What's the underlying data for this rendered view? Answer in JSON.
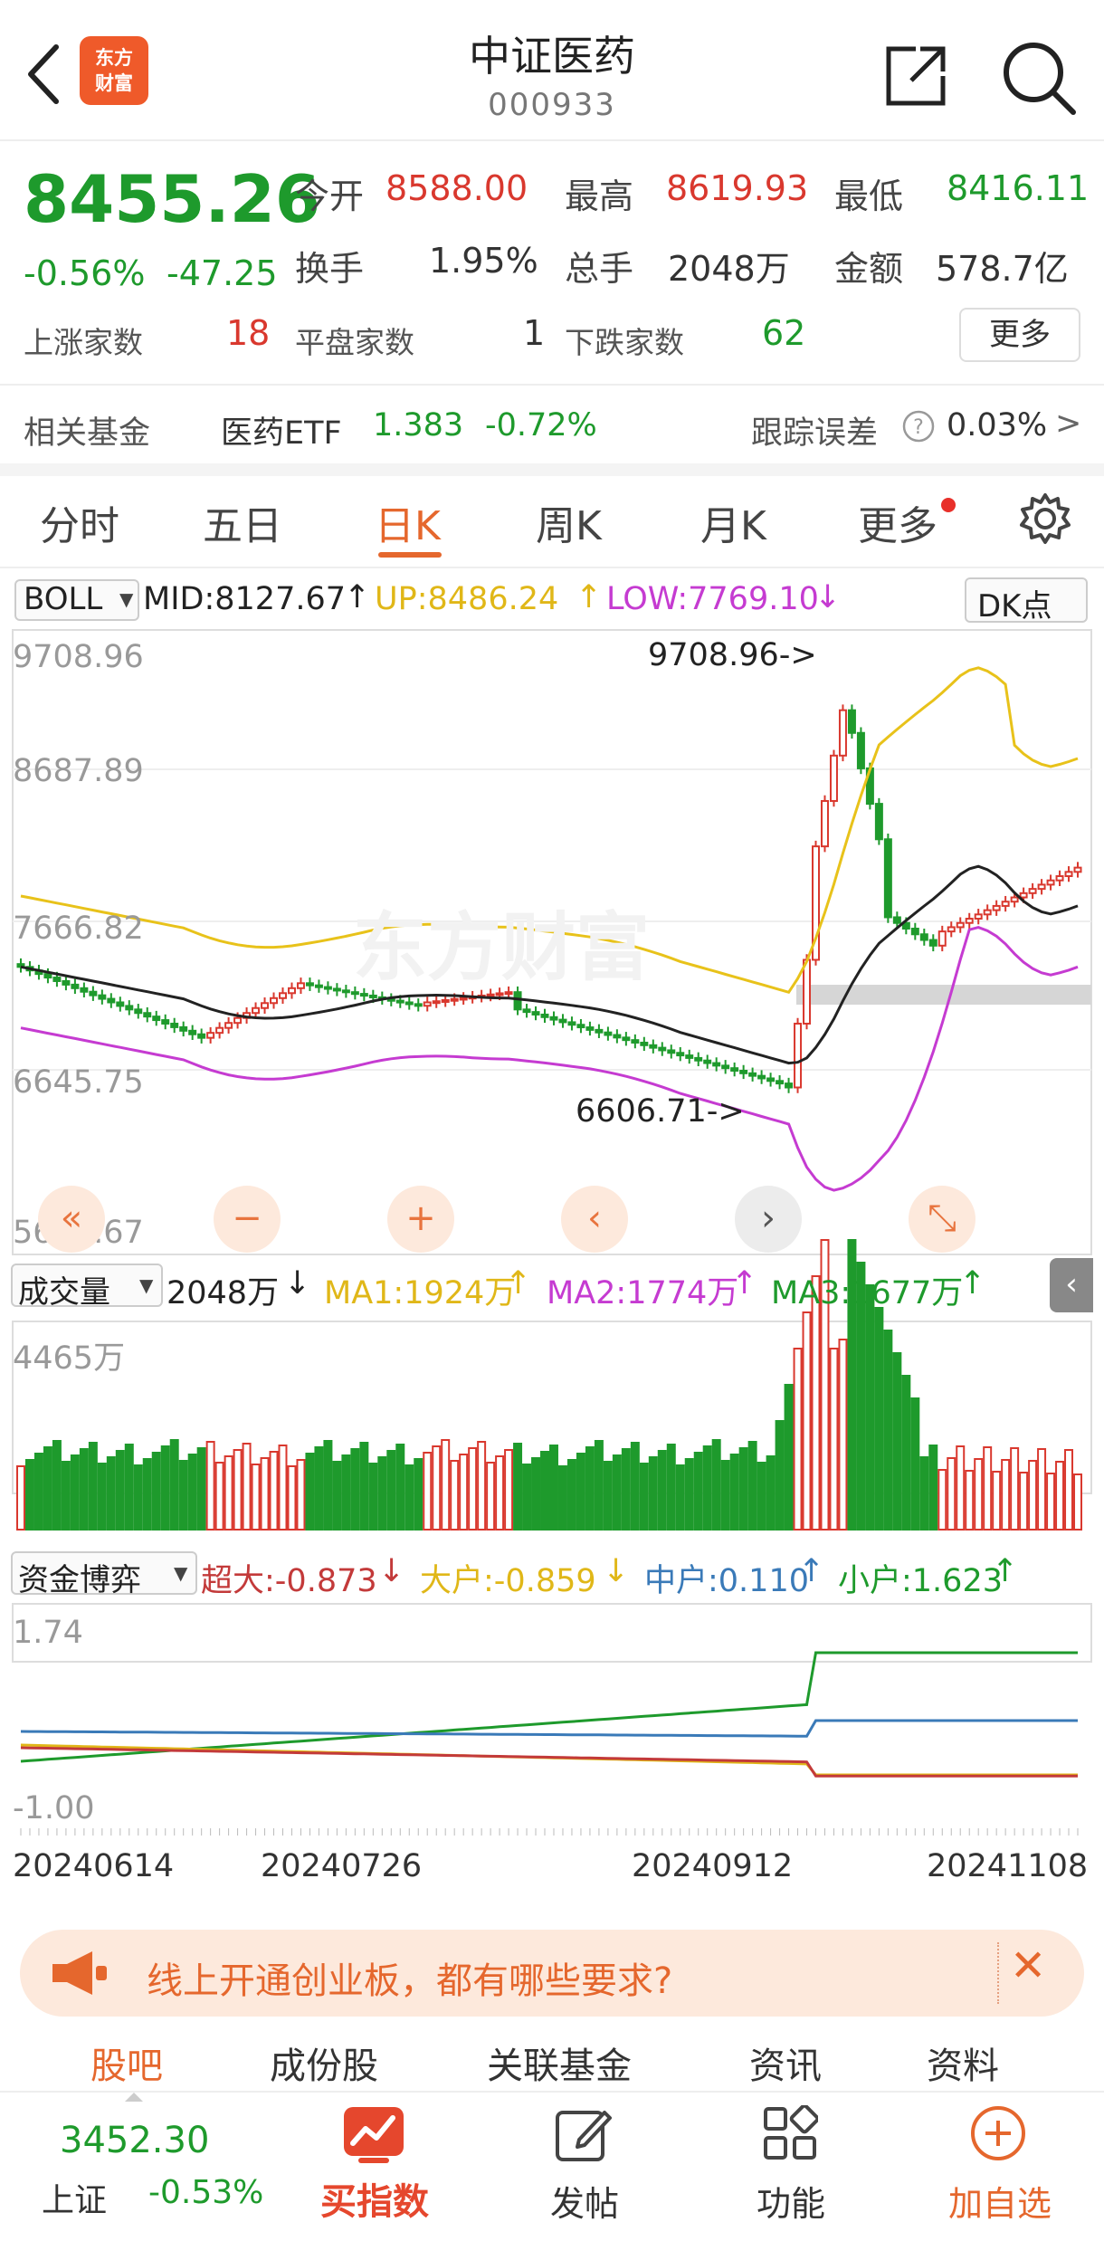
{
  "header": {
    "title": "中证医药",
    "code": "000933"
  },
  "quote": {
    "price": "8455.26",
    "change_pct": "-0.56%",
    "change": "-47.25",
    "open_label": "今开",
    "open": "8588.00",
    "high_label": "最高",
    "high": "8619.93",
    "low_label": "最低",
    "low": "8416.11",
    "turnover_label": "换手",
    "turnover": "1.95%",
    "volume_label": "总手",
    "volume": "2048万",
    "amount_label": "金额",
    "amount": "578.7亿",
    "up_label": "上涨家数",
    "up": "18",
    "flat_label": "平盘家数",
    "flat": "1",
    "down_label": "下跌家数",
    "down": "62",
    "more_button": "更多"
  },
  "fund": {
    "label": "相关基金",
    "name": "医药ETF",
    "price": "1.383",
    "pct": "-0.72%",
    "track_label": "跟踪误差",
    "track_icon": "question-icon",
    "track_value": "0.03%",
    "arrow": ">"
  },
  "tabs": [
    "分时",
    "五日",
    "日K",
    "周K",
    "月K",
    "更多"
  ],
  "active_tab": "日K",
  "boll": {
    "selector": "BOLL",
    "mid": "MID:8127.67",
    "up": "UP:8486.24",
    "low": "LOW:7769.10",
    "dk": "DK点",
    "arrow_up": "↑",
    "arrow_down": "↓"
  },
  "price_axis": {
    "labels": [
      "9708.96",
      "8687.89",
      "7666.82",
      "6645.75",
      "5624.67"
    ],
    "max_annot": "9708.96->",
    "min_annot": "6606.71->"
  },
  "volume": {
    "selector": "成交量",
    "value": "2048万",
    "ma1": "MA1:1924万",
    "ma2": "MA2:1774万",
    "ma3": "MA3:1677万",
    "axis": "4465万",
    "arrow_down": "↓",
    "arrow_up": "↑"
  },
  "flow": {
    "selector": "资金博弈",
    "xl": "超大:-0.873",
    "l": "大户:-0.859",
    "m": "中户:0.110",
    "s": "小户:1.623",
    "axis_top": "1.74",
    "axis_bottom": "-1.00",
    "arrow_down": "↓",
    "arrow_up": "↑"
  },
  "dates": [
    "20240614",
    "20240726",
    "20240912",
    "20241108"
  ],
  "watermark": "东方财富",
  "controls": [
    "«",
    "−",
    "+",
    "‹",
    "›",
    "⤡"
  ],
  "ad": {
    "text": "线上开通创业板，都有哪些要求?",
    "close": "✕"
  },
  "subtabs": [
    "股吧",
    "成份股",
    "关联基金",
    "资讯",
    "资料"
  ],
  "bottom": {
    "index_value": "3452.30",
    "index_name": "上证",
    "index_pct": "-0.53%",
    "items": [
      {
        "label": "买指数",
        "icon": "chart-trend-icon"
      },
      {
        "label": "发帖",
        "icon": "edit-icon"
      },
      {
        "label": "功能",
        "icon": "grid-icon"
      },
      {
        "label": "加自选",
        "icon": "plus-circle-icon"
      }
    ]
  },
  "colors": {
    "red": "#d9382e",
    "green": "#1e9a2c",
    "orange": "#e5672d",
    "boll_up": "#e8c21a",
    "boll_low": "#c53bd1",
    "mid": "#222222",
    "blue": "#3a7ab8"
  }
}
